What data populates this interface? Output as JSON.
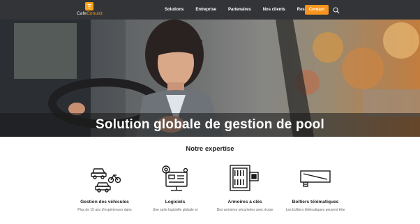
{
  "brand": {
    "logo_text_prefix": "Cafe",
    "logo_text_suffix": "Conuict",
    "accent": "#f7941d",
    "nav_bg": "#333438"
  },
  "nav": {
    "items": [
      {
        "label": "Solutions"
      },
      {
        "label": "Entreprise"
      },
      {
        "label": "Partenaires"
      },
      {
        "label": "Nos clients"
      },
      {
        "label": "Ressources"
      }
    ],
    "contact_label": "Contact",
    "search_icon": "search-icon",
    "dropdown_icon": "chevron-down-icon"
  },
  "hero": {
    "title": "Solution globale de gestion de pool"
  },
  "expertise": {
    "heading": "Notre expertise",
    "items": [
      {
        "icon": "vehicles-icon",
        "title": "Gestion des véhicules",
        "desc": "Plus de 15 ans d'expériences dans"
      },
      {
        "icon": "software-icon",
        "title": "Logiciels",
        "desc": "Une suite logicielle globale et"
      },
      {
        "icon": "key-cabinet-icon",
        "title": "Armoires à clés",
        "desc": "Des armoires sécurisées avec écran"
      },
      {
        "icon": "telematics-box-icon",
        "title": "Boîtiers télématiques",
        "desc": "Les boîtiers télématiques peuvent être"
      }
    ]
  }
}
